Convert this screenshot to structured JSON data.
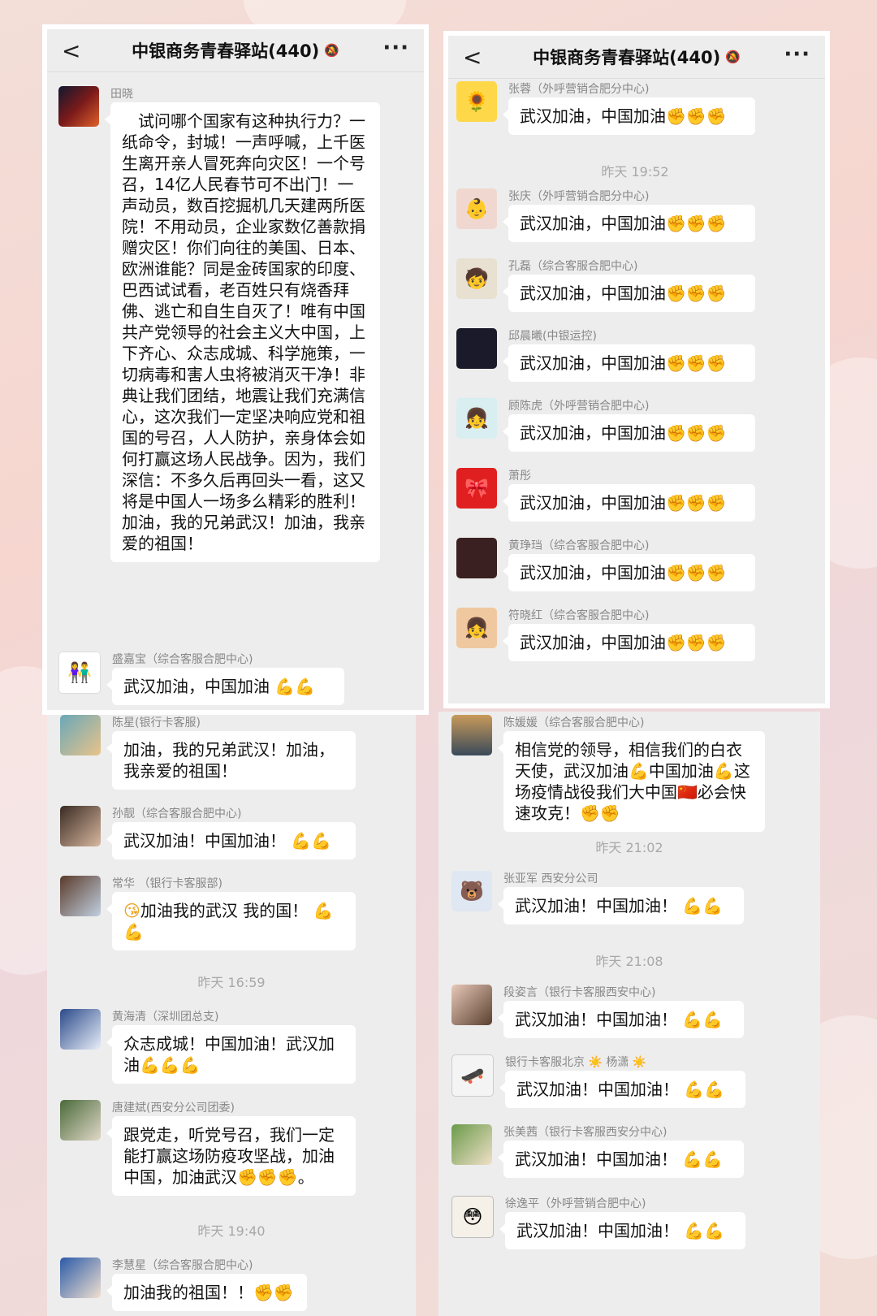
{
  "header": {
    "title": "中银商务青春驿站(440)",
    "back_icon": "chevron-left-icon",
    "mute_icon": "bell-off-icon",
    "more_icon": "more-icon"
  },
  "emoji": {
    "fist": "✊",
    "muscle": "💪",
    "flag": "🇨🇳",
    "face": "😘"
  },
  "panel_tl": {
    "msg1": {
      "sender": "田晓",
      "text": "　试问哪个国家有这种执行力？一纸命令，封城！一声呼喊，上千医生离开亲人冒死奔向灾区！一个号召，14亿人民春节可不出门！一声动员，数百挖掘机几天建两所医院！不用动员，企业家数亿善款捐赠灾区！你们向往的美国、日本、欧洲谁能？同是金砖国家的印度、巴西试试看，老百姓只有烧香拜佛、逃亡和自生自灭了！唯有中国共产党领导的社会主义大中国，上下齐心、众志成城、科学施策，一切病毒和害人虫将被消灭干净！非典让我们团结，地震让我们充满信心，这次我们一定坚决响应党和祖国的号召，人人防护，亲身体会如何打赢这场人民战争。因为，我们深信：不多久后再回头一看，这又将是中国人一场多么精彩的胜利！加油，我的兄弟武汉！加油，我亲爱的祖国！"
    },
    "msg2": {
      "sender": "盛嘉宝（综合客服合肥中心)",
      "text": "武汉加油，中国加油"
    }
  },
  "panel_tr": {
    "msg1": {
      "sender": "张蓉（外呼营销合肥分中心)",
      "text": "武汉加油，中国加油"
    },
    "time1": "昨天 19:52",
    "msgs": [
      {
        "sender": "张庆（外呼营销合肥分中心)",
        "text": "武汉加油，中国加油"
      },
      {
        "sender": "孔磊（综合客服合肥中心)",
        "text": "武汉加油，中国加油"
      },
      {
        "sender": "邱晨曦(中银运控)",
        "text": "武汉加油，中国加油"
      },
      {
        "sender": "顾陈虎（外呼营销合肥中心)",
        "text": "武汉加油，中国加油"
      },
      {
        "sender": "萧彤",
        "text": "武汉加油，中国加油"
      },
      {
        "sender": "黄琤珰（综合客服合肥中心)",
        "text": "武汉加油，中国加油"
      },
      {
        "sender": "符晓红（综合客服合肥中心)",
        "text": "武汉加油，中国加油"
      }
    ]
  },
  "panel_bl": {
    "msg1": {
      "sender": "陈星(银行卡客服)",
      "text": "加油，我的兄弟武汉！加油，我亲爱的祖国！"
    },
    "msg2": {
      "sender": "孙靓（综合客服合肥中心)",
      "text": "武汉加油！中国加油！"
    },
    "msg3": {
      "sender": "常华 （银行卡客服部)",
      "text": "加油我的武汉 我的国！"
    },
    "time1": "昨天 16:59",
    "msg4": {
      "sender": "黄海清（深圳团总支)",
      "text": "众志成城！中国加油！武汉加油"
    },
    "msg5": {
      "sender": "唐建斌(西安分公司团委)",
      "text": "跟党走，听党号召，我们一定能打赢这场防疫攻坚战，加油中国，加油武汉",
      "tail": "。"
    },
    "time2": "昨天 19:40",
    "msg6": {
      "sender": "李慧星（综合客服合肥中心)",
      "text": "加油我的祖国！！"
    }
  },
  "panel_br": {
    "msg1": {
      "sender": "陈媛媛（综合客服合肥中心)",
      "text1": "相信党的领导，相信我们的白衣天使，武汉加油",
      "text2": "中国加油",
      "text3": "这场疫情战役我们大中国",
      "text4": "必会快速攻克！"
    },
    "time1": "昨天 21:02",
    "msg2": {
      "sender": "张亚军 西安分公司",
      "text": "武汉加油！中国加油！"
    },
    "time2": "昨天 21:08",
    "msg3": {
      "sender": "段姿言（银行卡客服西安中心)",
      "text": "武汉加油！中国加油！"
    },
    "msg4": {
      "sender": "银行卡客服北京 ☀️ 杨潇 ☀️",
      "text": "武汉加油！中国加油！"
    },
    "msg5": {
      "sender": "张美茜（银行卡客服西安分中心)",
      "text": "武汉加油！中国加油！"
    },
    "msg6": {
      "sender": "徐逸平（外呼营销合肥中心)",
      "text": "武汉加油！中国加油！"
    }
  }
}
